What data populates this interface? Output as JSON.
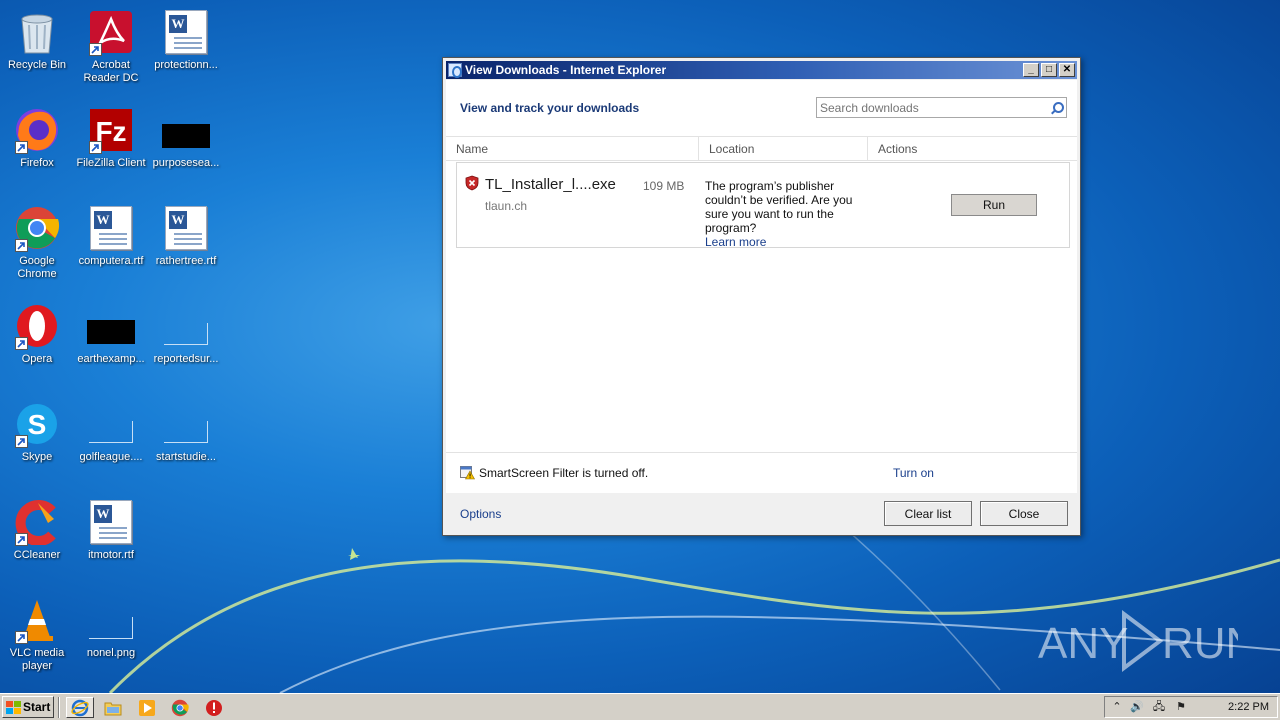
{
  "desktop": {
    "icons": [
      {
        "label": "Recycle Bin"
      },
      {
        "label": "Acrobat Reader DC"
      },
      {
        "label": "protectionn..."
      },
      {
        "label": "Firefox"
      },
      {
        "label": "FileZilla Client"
      },
      {
        "label": "purposesea..."
      },
      {
        "label": "Google Chrome"
      },
      {
        "label": "computera.rtf"
      },
      {
        "label": "rathertree.rtf"
      },
      {
        "label": "Opera"
      },
      {
        "label": "earthexamp..."
      },
      {
        "label": "reportedsur..."
      },
      {
        "label": "Skype"
      },
      {
        "label": "golfleague...."
      },
      {
        "label": "startstudie..."
      },
      {
        "label": "CCleaner"
      },
      {
        "label": "itmotor.rtf"
      },
      {
        "label": "VLC media player"
      },
      {
        "label": "nonel.png"
      }
    ],
    "watermark": "ANY RUN"
  },
  "dialog": {
    "title": "View Downloads - Internet Explorer",
    "header": "View and track your downloads",
    "search_placeholder": "Search downloads",
    "columns": [
      "Name",
      "Location",
      "Actions"
    ],
    "download": {
      "file_name": "TL_Installer_l....exe",
      "size": "109 MB",
      "domain": "tlaun.ch",
      "warning": "The program’s publisher couldn’t be verified. Are you sure you want to run the program?",
      "learn_more": "Learn more",
      "action": "Run"
    },
    "smartscreen_text": "SmartScreen Filter is turned off.",
    "turn_on": "Turn on",
    "options": "Options",
    "clear_list": "Clear list",
    "close": "Close"
  },
  "taskbar": {
    "start": "Start",
    "clock": "2:22 PM",
    "pinned": [
      "internet-explorer-icon",
      "explorer-folder-icon",
      "media-player-icon",
      "chrome-icon",
      "antivirus-icon"
    ]
  },
  "colors": {
    "title_bar_start": "#0a246a",
    "title_bar_end": "#6d93d6",
    "link": "#1a3f8c",
    "header": "#1b3a77"
  }
}
